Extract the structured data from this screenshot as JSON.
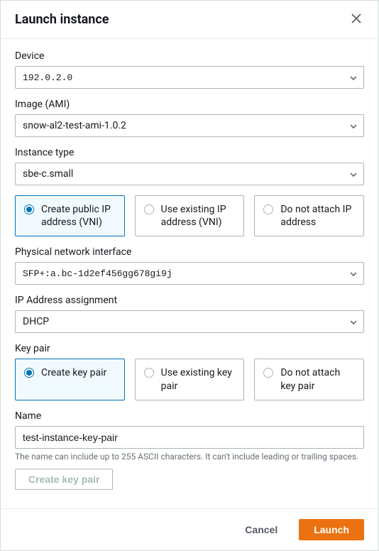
{
  "header": {
    "title": "Launch instance"
  },
  "fields": {
    "device": {
      "label": "Device",
      "value": "192.0.2.0"
    },
    "image": {
      "label": "Image (AMI)",
      "value": "snow-al2-test-ami-1.0.2"
    },
    "instanceType": {
      "label": "Instance type",
      "value": "sbe-c.small"
    },
    "ipRadio": {
      "options": [
        {
          "label": "Create public IP address (VNI)"
        },
        {
          "label": "Use existing IP address (VNI)"
        },
        {
          "label": "Do not attach IP address"
        }
      ],
      "selected": 0
    },
    "physicalInterface": {
      "label": "Physical network interface",
      "value": "SFP+:a.bc-1d2ef456gg678gi9j"
    },
    "ipAssignment": {
      "label": "IP Address assignment",
      "value": "DHCP"
    },
    "keyPair": {
      "label": "Key pair",
      "options": [
        {
          "label": "Create key pair"
        },
        {
          "label": "Use existing key pair"
        },
        {
          "label": "Do not attach key pair"
        }
      ],
      "selected": 0
    },
    "name": {
      "label": "Name",
      "value": "test-instance-key-pair",
      "helper": "The name can include up to 255 ASCII characters. It can't include leading or trailing spaces."
    },
    "createKeyPairButton": "Create key pair"
  },
  "footer": {
    "cancel": "Cancel",
    "launch": "Launch"
  }
}
